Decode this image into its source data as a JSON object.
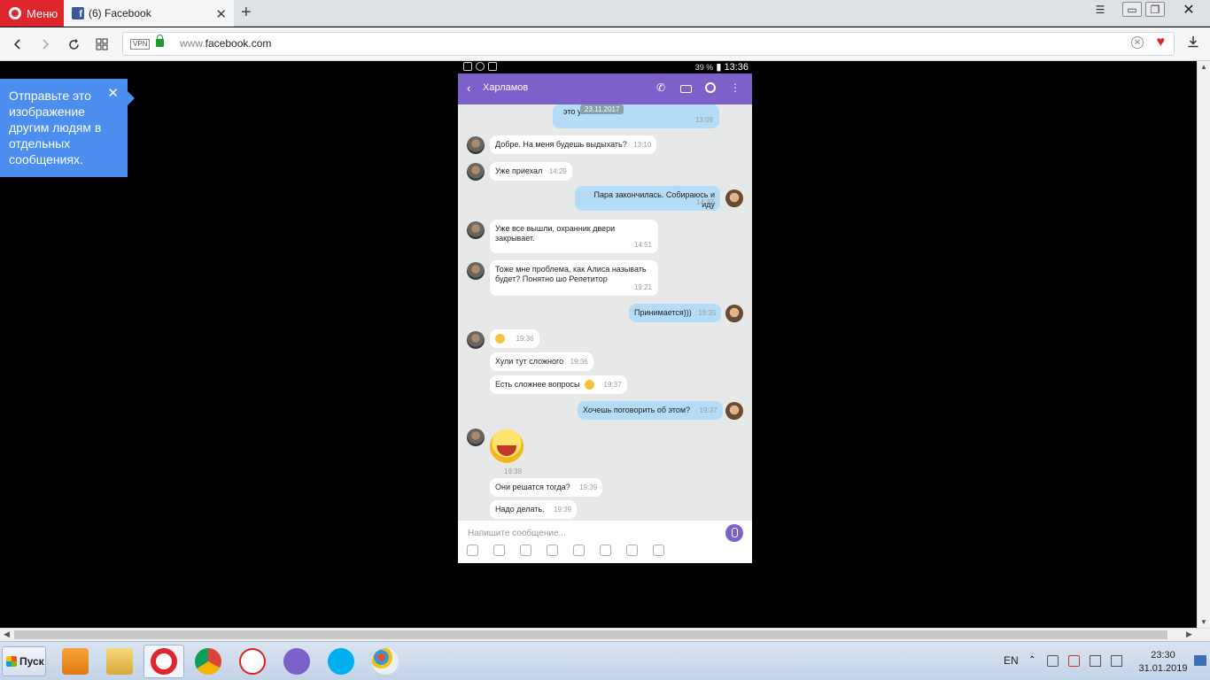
{
  "browser": {
    "menu_label": "Меню",
    "tab_title": "(6) Facebook",
    "favicon_letter": "f",
    "new_tab": "+",
    "close_tab": "✕",
    "vpn": "VPN",
    "url_prefix": "www.",
    "url_domain": "facebook.com",
    "win_minimize": "▭",
    "win_restore": "❐",
    "win_close": "✕"
  },
  "share_tooltip": {
    "text": "Отправьте это изображение другим людям в отдельных сообщениях.",
    "close": "✕"
  },
  "phone": {
    "status_battery": "39 %",
    "status_time": "13:36",
    "contact_name": "Харламов",
    "date_chip": "23.11.2017",
    "composer_placeholder": "Напишите сообщение...",
    "laugh_time": "19:38",
    "messages": [
      {
        "dir": "out",
        "text": "это улыбается",
        "time": "13:09"
      },
      {
        "dir": "in",
        "text": "Добре. На меня будешь выдыхать?",
        "time": "13:10"
      },
      {
        "dir": "in",
        "text": "Уже приехал",
        "time": "14:29"
      },
      {
        "dir": "out",
        "text": "Пара закончилась. Собираюсь и иду",
        "time": "14:33"
      },
      {
        "dir": "in",
        "text": "Уже все вышли, охранник двери закрывает.",
        "time": "14:51"
      },
      {
        "dir": "in",
        "text": "Тоже мне проблема, как Алиса называть будет? Понятно шо Репетитор",
        "time": "19:21"
      },
      {
        "dir": "out",
        "text": "Принимается)))",
        "time": "19:35"
      },
      {
        "dir": "in",
        "text": "",
        "time": "19:36"
      },
      {
        "dir": "in",
        "text": "Хули тут сложного",
        "time": "19:36"
      },
      {
        "dir": "in",
        "text": "Есть сложнее вопросы",
        "time": "19:37"
      },
      {
        "dir": "out",
        "text": "Хочешь поговорить об этом?",
        "time": "19:37"
      },
      {
        "dir": "in",
        "text": "Они решатся тогда?",
        "time": "19:39"
      },
      {
        "dir": "in",
        "text": "Надо делать.",
        "time": "19:39"
      }
    ]
  },
  "taskbar": {
    "start_label": "Пуск",
    "language": "EN",
    "time": "23:30",
    "date": "31.01.2019"
  },
  "colors": {
    "opera_red": "#e0262d",
    "viber_purple": "#7b61c9",
    "tooltip_blue": "#4b8ef0",
    "bubble_out": "#b5dcf6"
  }
}
